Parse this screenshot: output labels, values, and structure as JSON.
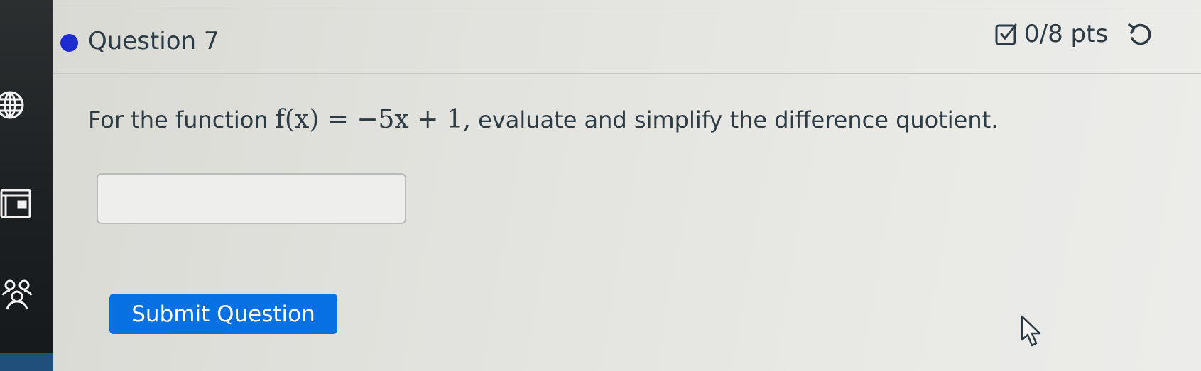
{
  "question": {
    "title": "Question 7",
    "points": "0/8 pts",
    "bullet_color": "#1d2bcf"
  },
  "prompt": {
    "before": "For the function",
    "math": "f(x) = −5x + 1,",
    "after": "evaluate and simplify the difference quotient."
  },
  "answer": {
    "value": "",
    "placeholder": ""
  },
  "submit": {
    "label": "Submit Question",
    "color": "#0770e3"
  },
  "icons": {
    "nav": [
      "globe-icon",
      "calendar-icon",
      "people-icon"
    ],
    "points": "checkbox-icon",
    "retry": "retry-icon",
    "pointer": "mouse-cursor-icon"
  }
}
